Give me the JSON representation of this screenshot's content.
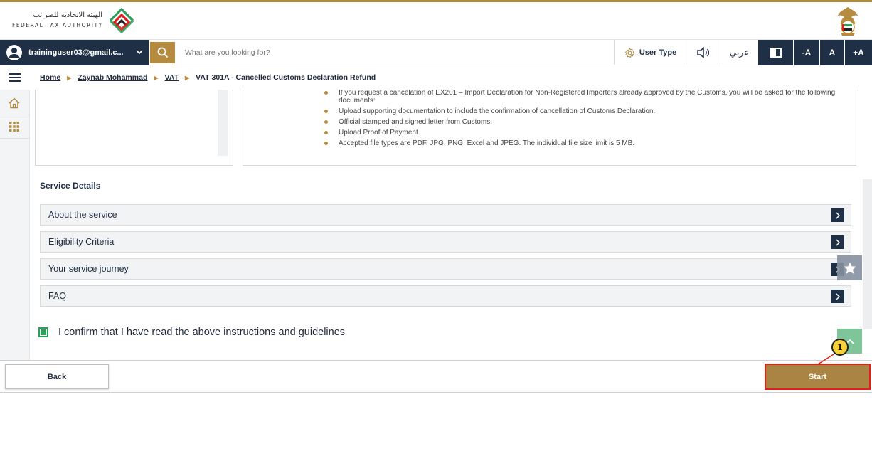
{
  "header": {
    "logo_ar": "الهيئة الاتحادية للضرائب",
    "logo_en": "FEDERAL TAX AUTHORITY"
  },
  "toolbar": {
    "user_email": "traininguser03@gmail.c...",
    "search_placeholder": "What are you looking for?",
    "user_type_label": "User Type",
    "language_label": "عربي",
    "font_decrease": "-A",
    "font_normal": "A",
    "font_increase": "+A"
  },
  "breadcrumb": {
    "items": [
      "Home",
      "Zaynab Mohammad",
      "VAT"
    ],
    "current": "VAT 301A - Cancelled Customs Declaration Refund"
  },
  "documents": [
    "If you request a cancelation of EX201 – Import Declaration for Non-Registered Importers already approved by the Customs, you will be asked for the following documents:",
    "Upload supporting documentation to include the confirmation of cancellation of Customs Declaration.",
    "Official stamped and signed letter from Customs.",
    "Upload Proof of Payment.",
    "Accepted file types are PDF, JPG, PNG, Excel and JPEG. The individual file size limit is 5 MB."
  ],
  "service_details": {
    "title": "Service Details",
    "accordions": [
      "About the service",
      "Eligibility Criteria",
      "Your service journey",
      "FAQ"
    ]
  },
  "confirmation": {
    "text": "I confirm that I have read the above instructions and guidelines",
    "checked": true
  },
  "footer": {
    "back_label": "Back",
    "start_label": "Start"
  },
  "annotation": {
    "number": "1"
  },
  "colors": {
    "navy": "#1f2f45",
    "gold": "#b58b3f",
    "start_button": "#a98443",
    "highlight_border": "#e0201d",
    "checkbox_green": "#2e9e5b"
  }
}
